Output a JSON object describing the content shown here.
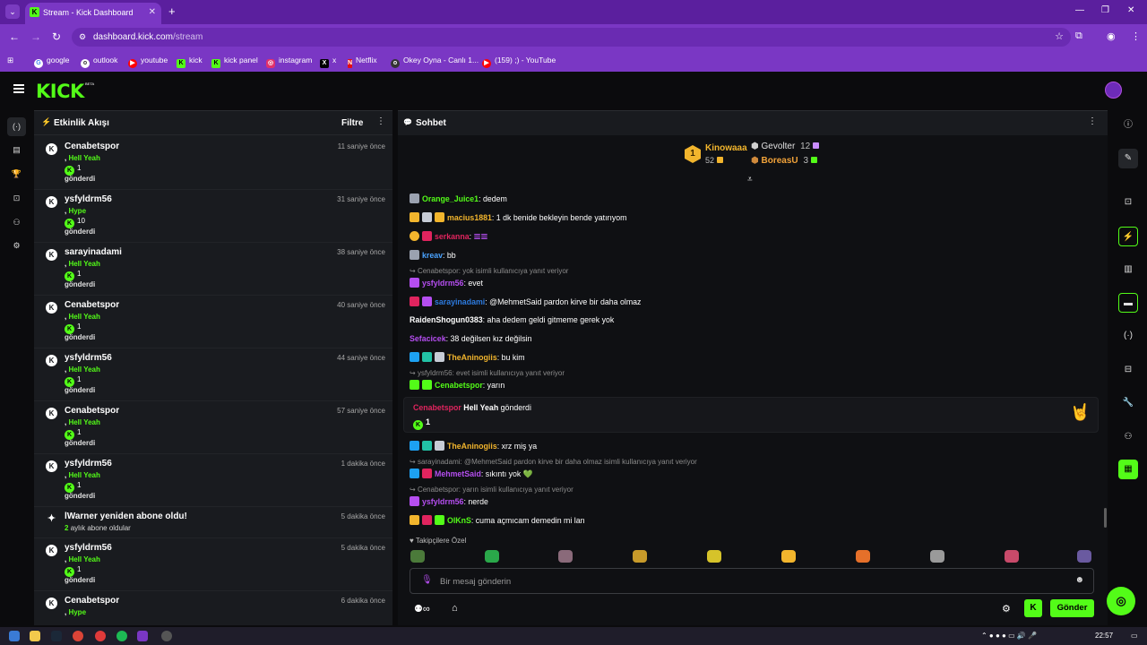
{
  "browser": {
    "tab_title": "Stream - Kick Dashboard",
    "url_host": "dashboard.kick.com",
    "url_path": "/stream",
    "bookmarks": [
      {
        "label": "google",
        "color": "#ffffff",
        "glyph": "G"
      },
      {
        "label": "outlook",
        "color": "#ffffff",
        "glyph": "o"
      },
      {
        "label": "youtube",
        "color": "#ff0000",
        "glyph": "▶"
      },
      {
        "label": "kick",
        "color": "#53fc18",
        "glyph": "K"
      },
      {
        "label": "kick panel",
        "color": "#53fc18",
        "glyph": "K"
      },
      {
        "label": "instagram",
        "color": "#e1306c",
        "glyph": "◎"
      },
      {
        "label": "x",
        "color": "#000000",
        "glyph": "X"
      },
      {
        "label": "Netflix",
        "color": "#e50914",
        "glyph": "N"
      },
      {
        "label": "Okey Oyna - Canlı 1...",
        "color": "#333333",
        "glyph": "o"
      },
      {
        "label": "(159) ;) - YouTube",
        "color": "#ff0000",
        "glyph": "▶"
      }
    ]
  },
  "header": {
    "logo": "KICK",
    "beta": "BETA"
  },
  "activity": {
    "title": "Etkinlik Akışı",
    "filter": "Filtre",
    "items": [
      {
        "user": "Cenabetspor",
        "time": "11 saniye önce",
        "item": "Hell Yeah",
        "qty": "1",
        "action": "gönderdi"
      },
      {
        "user": "ysfyldrm56",
        "time": "31 saniye önce",
        "item": "Hype",
        "qty": "10",
        "action": "gönderdi"
      },
      {
        "user": "sarayinadami",
        "time": "38 saniye önce",
        "item": "Hell Yeah",
        "qty": "1",
        "action": "gönderdi"
      },
      {
        "user": "Cenabetspor",
        "time": "40 saniye önce",
        "item": "Hell Yeah",
        "qty": "1",
        "action": "gönderdi"
      },
      {
        "user": "ysfyldrm56",
        "time": "44 saniye önce",
        "item": "Hell Yeah",
        "qty": "1",
        "action": "gönderdi"
      },
      {
        "user": "Cenabetspor",
        "time": "57 saniye önce",
        "item": "Hell Yeah",
        "qty": "1",
        "action": "gönderdi"
      },
      {
        "user": "ysfyldrm56",
        "time": "1 dakika önce",
        "item": "Hell Yeah",
        "qty": "1",
        "action": "gönderdi"
      }
    ],
    "sub_item": {
      "title": "lWarner yeniden abone oldu!",
      "time": "5 dakika önce",
      "months": "2",
      "sub_text": "aylık abone oldular"
    },
    "items_after": [
      {
        "user": "ysfyldrm56",
        "time": "5 dakika önce",
        "item": "Hell Yeah",
        "qty": "1",
        "action": "gönderdi"
      },
      {
        "user": "Cenabetspor",
        "time": "6 dakika önce",
        "item": "Hype",
        "qty": "",
        "action": ""
      }
    ]
  },
  "chat": {
    "title": "Sohbet",
    "leaderboard": {
      "first": {
        "rank": "1",
        "name": "Kinowaaa",
        "count": "52"
      },
      "second": {
        "name": "Gevolter",
        "count": "12"
      },
      "third": {
        "name": "BoreasU",
        "count": "3"
      }
    },
    "messages": [
      {
        "user": "Orange_Juice1",
        "color": "#53fc18",
        "text": ": dedem"
      },
      {
        "user": "macius1881",
        "color": "#f2b52d",
        "text": ": 1 dk benide bekleyin bende yatırıyom"
      },
      {
        "user": "serkanna",
        "color": "#e0245e",
        "text": ": "
      },
      {
        "user": "kreav",
        "color": "#4aa3ff",
        "text": ": bb"
      },
      {
        "reply": "Cenabetspor: yok isimli kullanıcıya yanıt veriyor"
      },
      {
        "user": "ysfyldrm56",
        "color": "#b54ef0",
        "text": ": evet"
      },
      {
        "user": "sarayinadami",
        "color": "#2d7be0",
        "text": ": @MehmetSaid pardon kirve bir daha olmaz"
      },
      {
        "user": "RaidenShogun0383",
        "color": "#ffffff",
        "text": ": aha dedem geldi gitmeme gerek yok"
      },
      {
        "user": "Sefacicek",
        "color": "#b54ef0",
        "text": ": 38 değilsen kız değilsin"
      },
      {
        "user": "TheAninogiis",
        "color": "#f2b52d",
        "text": ": bu kim"
      },
      {
        "reply": "ysfyldrm56: evet isimli kullanıcıya yanıt veriyor"
      },
      {
        "user": "Cenabetspor",
        "color": "#53fc18",
        "text": ": yarın"
      }
    ],
    "gift": {
      "user": "Cenabetspor",
      "item": "Hell Yeah",
      "action": "gönderdi",
      "qty": "1"
    },
    "messages_after": [
      {
        "user": "TheAninogiis",
        "color": "#f2b52d",
        "text": ": xrz miş ya"
      },
      {
        "reply": "sarayinadami: @MehmetSaid pardon kirve bir daha olmaz isimli kullanıcıya yanıt veriyor"
      },
      {
        "user": "MehmetSaid",
        "color": "#b54ef0",
        "text": ": sıkıntı yok 💚"
      },
      {
        "reply": "Cenabetspor: yarın isimli kullanıcıya yanıt veriyor"
      },
      {
        "user": "ysfyldrm56",
        "color": "#b54ef0",
        "text": ": nerde"
      },
      {
        "user": "OlKnS",
        "color": "#53fc18",
        "text": ": cuma açmıcam demedin mi lan"
      }
    ],
    "emote_label": "Takipçilere Özel",
    "input_placeholder": "Bir mesaj gönderin",
    "send_label": "Gönder"
  },
  "taskbar": {
    "time": "22:57"
  },
  "colors": {
    "accent": "#53fc18",
    "browser": "#7a37c4",
    "panel": "#191b1f"
  }
}
